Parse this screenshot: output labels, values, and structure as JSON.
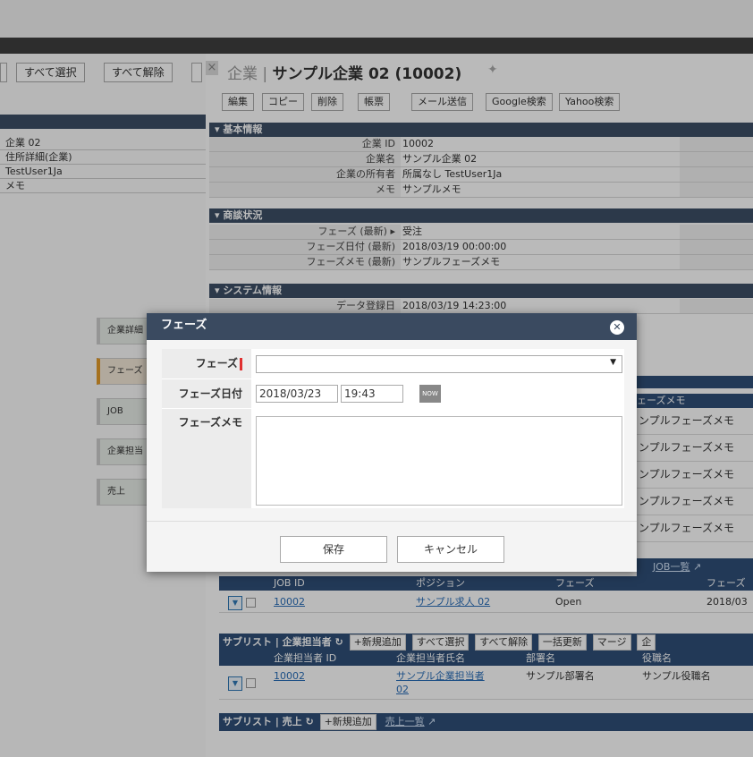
{
  "left": {
    "toolbar": {
      "select_all": "すべて選択",
      "deselect_all": "すべて解除"
    },
    "list": [
      "企業 02",
      "住所詳細(企業)",
      "TestUser1Ja",
      "メモ"
    ],
    "docks": [
      "企業詳細",
      "フェーズ",
      "JOB",
      "企業担当",
      "売上"
    ]
  },
  "record": {
    "title_prefix": "企業",
    "title_sep": "|",
    "title_name": "サンプル企業 02 (10002)",
    "pin_icon": "pin-icon",
    "toolbar": [
      "編集",
      "コピー",
      "削除",
      "帳票",
      "メール送信",
      "Google検索",
      "Yahoo検索"
    ],
    "sections": {
      "basic": "▾ 基本情報",
      "deal": "▾ 商談状況",
      "system": "▾ システム情報"
    },
    "basic_fields": [
      {
        "label": "企業 ID",
        "value": "10002"
      },
      {
        "label": "企業名",
        "value": "サンプル企業 02"
      },
      {
        "label": "企業の所有者",
        "value": "所属なし TestUser1Ja"
      },
      {
        "label": "メモ",
        "value": "サンプルメモ"
      }
    ],
    "deal_fields": [
      {
        "label": "フェーズ (最新) ▸",
        "value": "受注"
      },
      {
        "label": "フェーズ日付 (最新)",
        "value": "2018/03/19 00:00:00"
      },
      {
        "label": "フェーズメモ (最新)",
        "value": "サンプルフェーズメモ"
      }
    ],
    "system_fields": [
      {
        "label": "データ登録日",
        "value": "2018/03/19 14:23:00"
      }
    ],
    "phase_memo_col_header": "ェーズメモ",
    "phase_memo_rows": [
      "ンプルフェーズメモ",
      "ンプルフェーズメモ",
      "ンプルフェーズメモ",
      "ンプルフェーズメモ",
      "ンプルフェーズメモ"
    ],
    "job_list_link": "JOB一覧",
    "job_table": {
      "headers": [
        "JOB ID",
        "ポジション",
        "フェーズ",
        "フェーズ"
      ],
      "row": [
        "10002",
        "サンプル求人 02",
        "Open",
        "2018/03"
      ]
    },
    "sublist_contact": {
      "title": "サブリスト | 企業担当者",
      "buttons": [
        "+新規追加",
        "すべて選択",
        "すべて解除",
        "一括更新",
        "マージ",
        "企"
      ],
      "headers": [
        "企業担当者 ID",
        "企業担当者氏名",
        "部署名",
        "役職名"
      ],
      "row": [
        "10002",
        "サンプル企業担当者 02",
        "サンプル部署名",
        "サンプル役職名"
      ]
    },
    "sublist_sales": {
      "title": "サブリスト | 売上",
      "add": "+新規追加",
      "list_link": "売上一覧"
    }
  },
  "modal": {
    "title": "フェーズ",
    "phase_label": "フェーズ",
    "phase_value": "",
    "date_label": "フェーズ日付",
    "date_value": "2018/03/23",
    "time_value": "19:43",
    "now_label": "NOW",
    "memo_label": "フェーズメモ",
    "memo_value": "",
    "save_label": "保存",
    "cancel_label": "キャンセル"
  }
}
